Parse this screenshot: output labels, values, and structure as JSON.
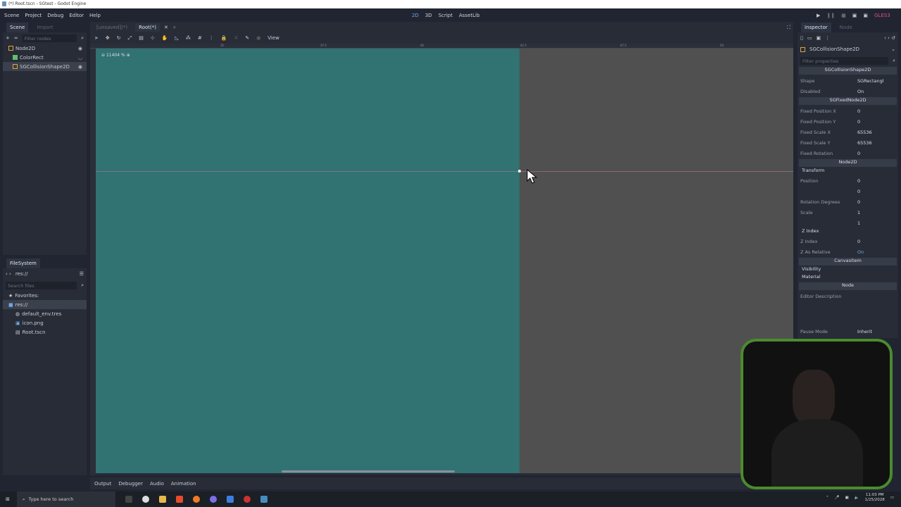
{
  "window_title": "(*) Root.tscn - SGtest - Godot Engine",
  "menu": [
    "Scene",
    "Project",
    "Debug",
    "Editor",
    "Help"
  ],
  "workspaces": [
    "2D",
    "3D",
    "Script",
    "AssetLib"
  ],
  "renderer": "GLES3",
  "scene_dock": {
    "tabs": [
      "Scene",
      "Import"
    ],
    "filter_placeholder": "Filter nodes",
    "nodes": [
      "Node2D",
      "ColorRect",
      "SGCollisionShape2D"
    ]
  },
  "filesystem": {
    "title": "FileSystem",
    "path": "res://",
    "search_placeholder": "Search files",
    "favorites": "Favorites:",
    "root": "res://",
    "files": [
      "default_env.tres",
      "icon.png",
      "Root.tscn"
    ]
  },
  "viewport": {
    "tabs": [
      "[unsaved](*)",
      "Root(*)"
    ],
    "view_menu": "View",
    "zoom": "11404 %",
    "ruler_labels": [
      "35",
      "37.5",
      "40",
      "42.5",
      "45",
      "47.5",
      "50"
    ]
  },
  "bottom_tabs": [
    "Output",
    "Debugger",
    "Audio",
    "Animation"
  ],
  "inspector": {
    "tabs": [
      "Inspector",
      "Node"
    ],
    "object": "SGCollisionShape2D",
    "filter_placeholder": "Filter properties",
    "section_sg": "SGCollisionShape2D",
    "shape_label": "Shape",
    "shape_value": "SGRectangl",
    "disabled_label": "Disabled",
    "disabled_value": "On",
    "section_fixed": "SGFixedNode2D",
    "fixed": [
      {
        "label": "Fixed Position X",
        "value": "0"
      },
      {
        "label": "Fixed Position Y",
        "value": "0"
      },
      {
        "label": "Fixed Scale X",
        "value": "65536"
      },
      {
        "label": "Fixed Scale Y",
        "value": "65536"
      },
      {
        "label": "Fixed Rotation",
        "value": "0"
      }
    ],
    "section_node2d": "Node2D",
    "transform": "Transform",
    "position_label": "Position",
    "pos_x": "0",
    "pos_y": "0",
    "rotation_label": "Rotation Degrees",
    "rotation": "0",
    "scale_label": "Scale",
    "scale_x": "1",
    "scale_y": "1",
    "zindex_group": "Z Index",
    "zindex_label": "Z Index",
    "zindex": "0",
    "zrel_label": "Z As Relative",
    "zrel": "On",
    "section_canvas": "CanvasItem",
    "visibility": "Visibility",
    "material": "Material",
    "section_node": "Node",
    "editor_desc": "Editor Description",
    "pause_label": "Pause Mode",
    "pause_value": "Inherit"
  },
  "taskbar": {
    "search_placeholder": "Type here to search",
    "time": "11:03 PM",
    "date": "1/25/2028"
  }
}
